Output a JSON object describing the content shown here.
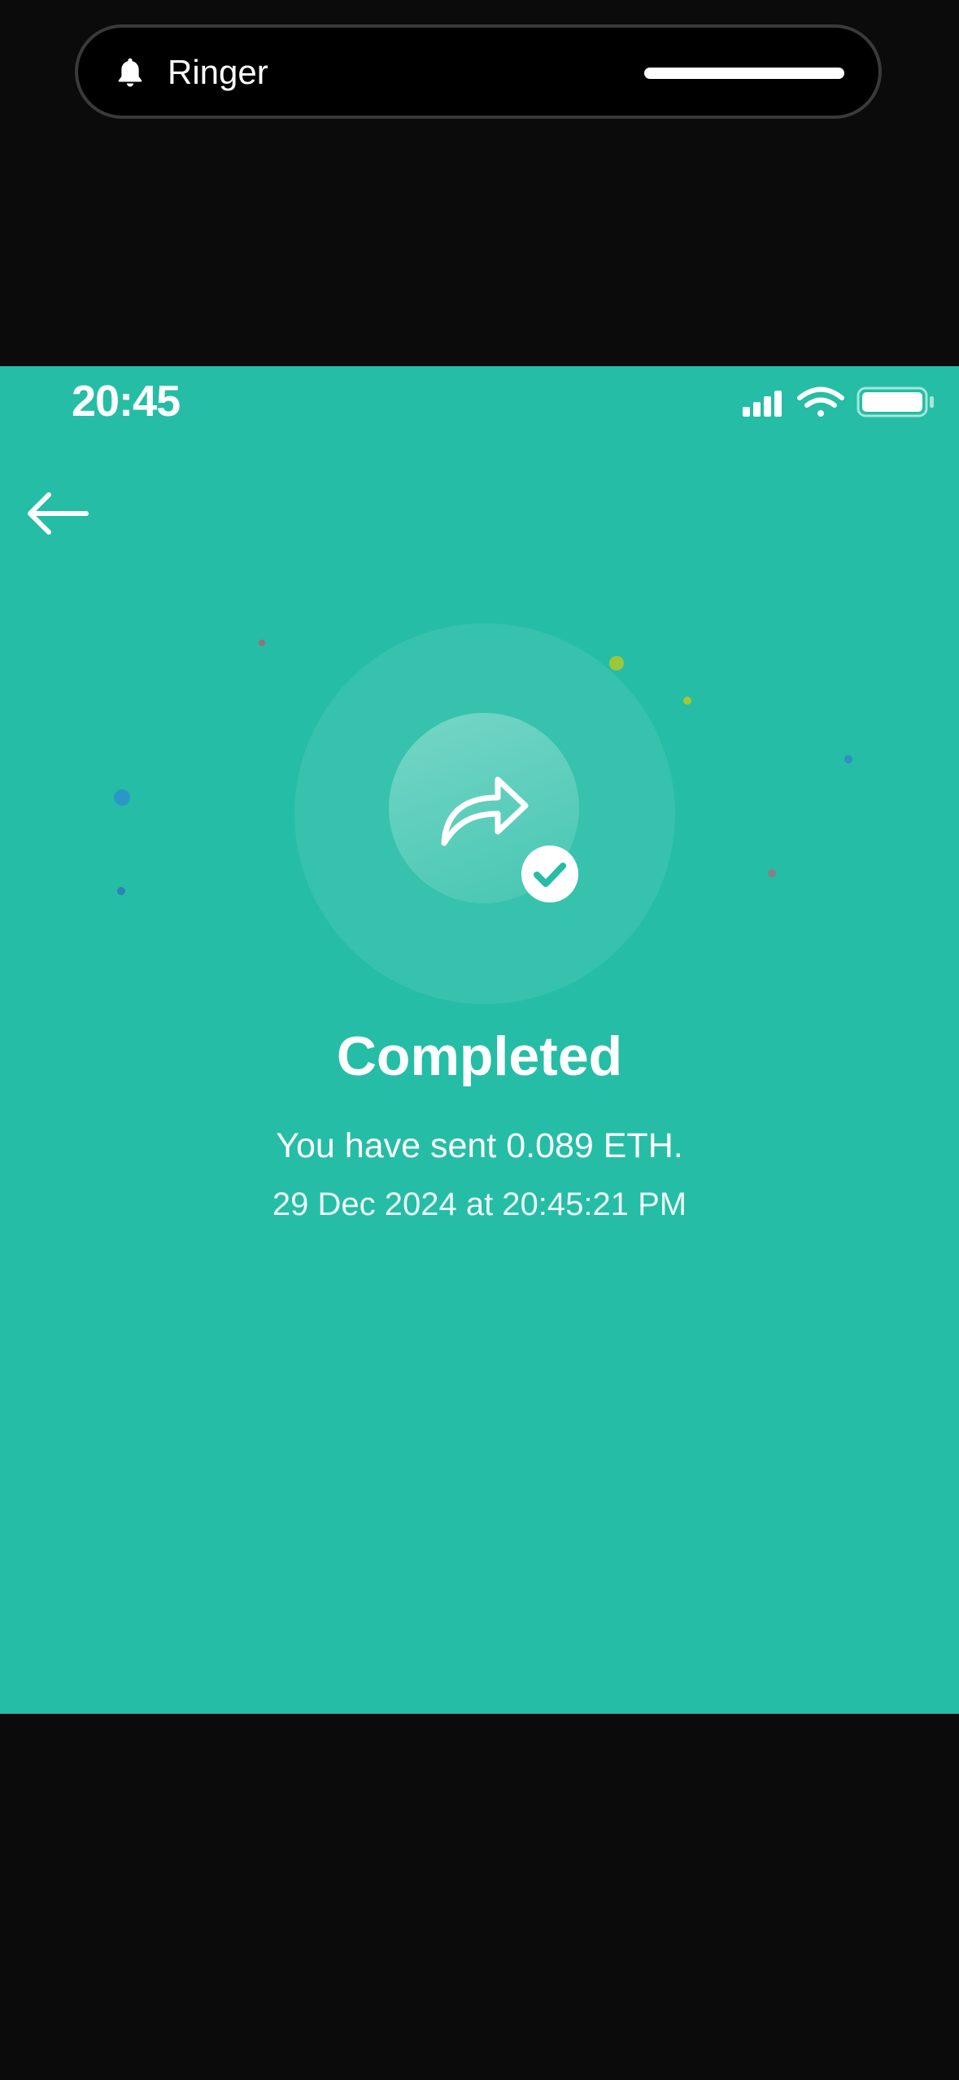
{
  "ringer": {
    "label": "Ringer",
    "icon": "bell-icon",
    "volume_level": 1.0
  },
  "status_bar": {
    "time": "20:45",
    "icons": [
      "cellular-signal-icon",
      "wifi-icon",
      "battery-icon"
    ]
  },
  "nav": {
    "back_icon": "arrow-left-icon"
  },
  "transaction": {
    "icon": "share-forward-icon",
    "badge_icon": "check-icon",
    "title": "Completed",
    "message": "You have sent 0.089 ETH.",
    "timestamp": "29 Dec 2024 at 20:45:21 PM"
  },
  "colors": {
    "background": "#25bda5",
    "outer": "#0b0b0b",
    "text": "#ffffff",
    "badge_check": "#25bda5"
  }
}
